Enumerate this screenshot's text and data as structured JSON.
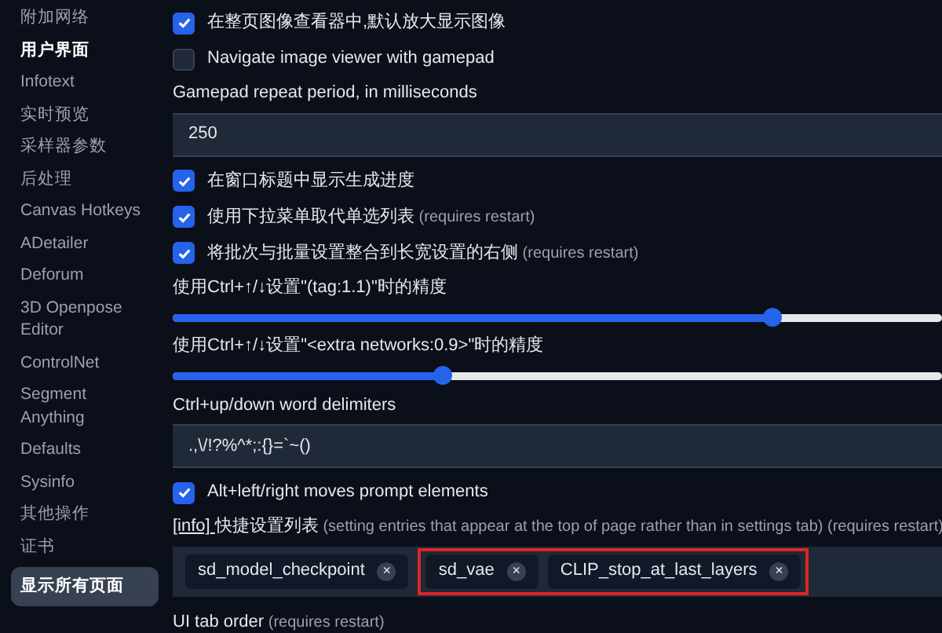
{
  "sidebar": {
    "items": [
      {
        "label": "附加网络",
        "selected": false,
        "current": false
      },
      {
        "label": "用户界面",
        "selected": false,
        "current": true
      },
      {
        "label": "Infotext",
        "selected": false
      },
      {
        "label": "实时预览",
        "selected": false
      },
      {
        "label": "采样器参数",
        "selected": false
      },
      {
        "label": "后处理",
        "selected": false
      },
      {
        "label": "Canvas Hotkeys",
        "selected": false
      },
      {
        "label": "ADetailer",
        "selected": false
      },
      {
        "label": "Deforum",
        "selected": false
      },
      {
        "label": "3D Openpose Editor",
        "selected": false
      },
      {
        "label": "ControlNet",
        "selected": false
      },
      {
        "label": "Segment Anything",
        "selected": false
      },
      {
        "label": "Defaults",
        "selected": false
      },
      {
        "label": "Sysinfo",
        "selected": false
      },
      {
        "label": "其他操作",
        "selected": false
      },
      {
        "label": "证书",
        "selected": false
      },
      {
        "label": "显示所有页面",
        "selected": true
      }
    ]
  },
  "settings": [
    {
      "kind": "checkbox",
      "label": "在整页图像查看器中,默认放大显示图像",
      "checked": true
    },
    {
      "kind": "checkbox",
      "label": "Navigate image viewer with gamepad",
      "checked": false
    },
    {
      "kind": "text",
      "label": "Gamepad repeat period, in milliseconds",
      "value": "250"
    },
    {
      "kind": "checkbox",
      "label": "在窗口标题中显示生成进度",
      "checked": true
    },
    {
      "kind": "checkbox",
      "label": "使用下拉菜单取代单选列表",
      "note": "(requires restart)",
      "checked": true
    },
    {
      "kind": "checkbox",
      "label": "将批次与批量设置整合到长宽设置的右侧",
      "note": "(requires restart)",
      "checked": true
    },
    {
      "kind": "slider",
      "label": "使用Ctrl+↑/↓设置\"(tag:1.1)\"时的精度",
      "level": 0.78
    },
    {
      "kind": "slider",
      "label": "使用Ctrl+↑/↓设置\"<extra networks:0.9>\"时的精度",
      "level": 0.35
    },
    {
      "kind": "text",
      "label": "Ctrl+up/down word delimiters",
      "value": ".,\\/!?%^*;:{}=`~()"
    },
    {
      "kind": "checkbox",
      "label": "Alt+left/right moves prompt elements",
      "checked": true
    },
    {
      "kind": "tags",
      "info": "[info]",
      "label": "快捷设置列表",
      "note": "(setting entries that appear at the top of page rather than in settings tab) (requires restart)",
      "tags": [
        {
          "label": "sd_model_checkpoint",
          "highlighted": false
        },
        {
          "label": "sd_vae",
          "highlighted": true
        },
        {
          "label": "CLIP_stop_at_last_layers",
          "highlighted": true
        }
      ],
      "remove": "×"
    },
    {
      "kind": "heading",
      "label": "UI tab order",
      "note": "(requires restart)"
    }
  ]
}
